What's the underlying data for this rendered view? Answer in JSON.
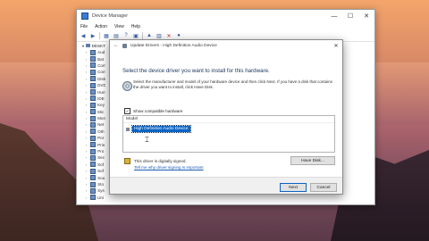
{
  "device_manager": {
    "title": "Device Manager",
    "menu": [
      "File",
      "Action",
      "View",
      "Help"
    ],
    "window_buttons": [
      "—",
      "☐",
      "✕"
    ],
    "tree_root": "DESKT",
    "tree_items": [
      "Aud",
      "Bat",
      "Com",
      "Com",
      "Disk",
      "DVD",
      "Hum",
      "IDE",
      "Key",
      "Mic",
      "Mon",
      "Net",
      "Oth",
      "Por",
      "Prin",
      "Pro",
      "Sec",
      "Sof",
      "Sof",
      "Sou",
      "Sto",
      "Sys",
      "Uni"
    ]
  },
  "update_drivers": {
    "title": "Update Drivers - High Definition Audio Device",
    "heading": "Select the device driver you want to install for this hardware.",
    "description": "Select the manufacturer and model of your hardware device and then click Next. If you have a disk that contains the driver you want to install, click Have Disk.",
    "show_compatible_label": "Show compatible hardware",
    "show_compatible_checked": true,
    "model_header": "Model",
    "selected_model": "High Definition Audio Device",
    "signed_text": "This driver is digitally signed.",
    "signing_link": "Tell me why driver signing is important",
    "have_disk_label": "Have Disk...",
    "next_label": "Next",
    "cancel_label": "Cancel",
    "close_glyph": "✕",
    "back_glyph": "←"
  }
}
